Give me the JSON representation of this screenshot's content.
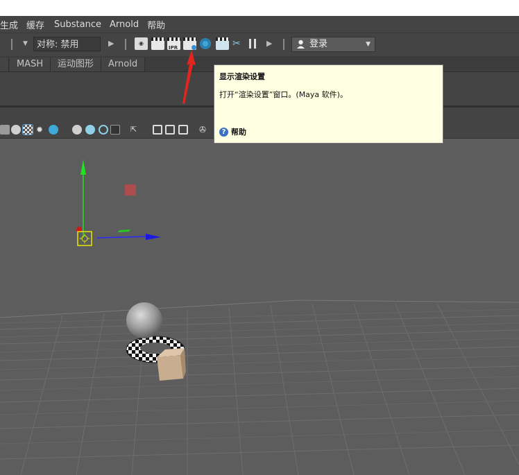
{
  "menubar": {
    "items": [
      "生成",
      "缓存",
      "Substance",
      "Arnold",
      "帮助"
    ]
  },
  "toolbar": {
    "symmetry_value": "对称: 禁用",
    "render_icons": [
      "eye-render-icon",
      "render-current-frame-icon",
      "ipr-render-icon",
      "render-settings-icon",
      "hypershade-icon",
      "render-view-icon",
      "light-editor-icon",
      "pause-icon"
    ],
    "ipr_label": "IPR",
    "login_label": "登录"
  },
  "tabs": [
    "MASH",
    "运动图形",
    "Arnold"
  ],
  "tooltip": {
    "title": "显示渲染设置",
    "description": "打开“渲染设置”窗口。(Maya 软件)。",
    "help_label": "帮助"
  },
  "colors": {
    "panel_bg": "#444444",
    "viewport_bg": "#5d5d5d",
    "tooltip_bg": "#ffffe1",
    "annotation_arrow": "#e0261f"
  }
}
